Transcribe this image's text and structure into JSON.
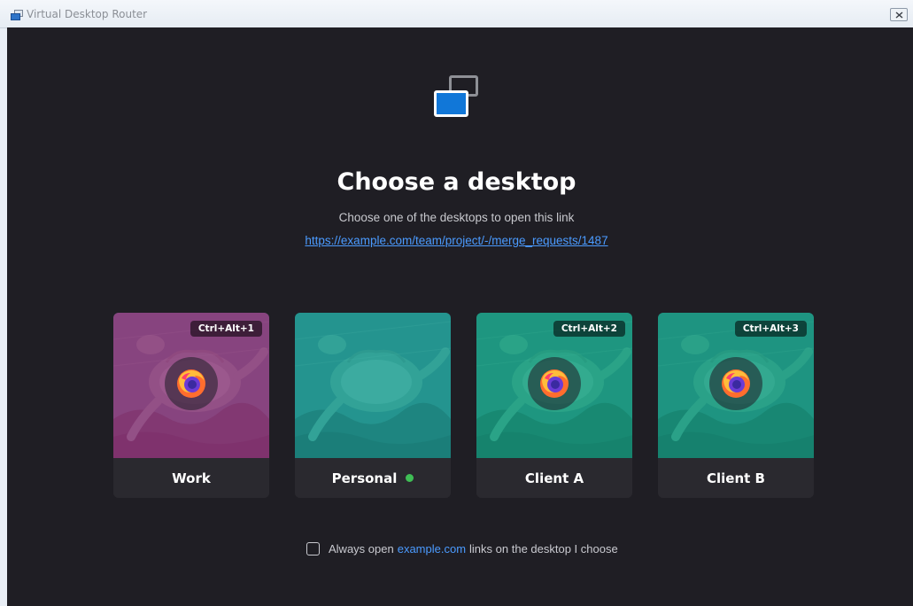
{
  "window": {
    "title": "Virtual Desktop Router"
  },
  "header": {
    "heading": "Choose a desktop",
    "subheading": "Choose one of the desktops to open this link",
    "url": "https://example.com/team/project/-/merge_requests/1487"
  },
  "desktops": [
    {
      "name": "Work",
      "shortcut": "Ctrl+Alt+1",
      "tint": "#c02a86",
      "browser_icon": "firefox-icon",
      "active": false
    },
    {
      "name": "Personal",
      "shortcut": "",
      "tint": "#1fb3a6",
      "browser_icon": "",
      "active": true
    },
    {
      "name": "Client A",
      "shortcut": "Ctrl+Alt+2",
      "tint": "#15b089",
      "browser_icon": "firefox-icon",
      "active": false
    },
    {
      "name": "Client B",
      "shortcut": "Ctrl+Alt+3",
      "tint": "#16ae8a",
      "browser_icon": "firefox-icon",
      "active": false
    }
  ],
  "remember": {
    "prefix": "Always open",
    "domain": "example.com",
    "suffix": "links on the desktop I choose",
    "checked": false
  },
  "colors": {
    "accent": "#4b9bff",
    "active_dot": "#3fbe55",
    "background": "#1f1e24"
  }
}
